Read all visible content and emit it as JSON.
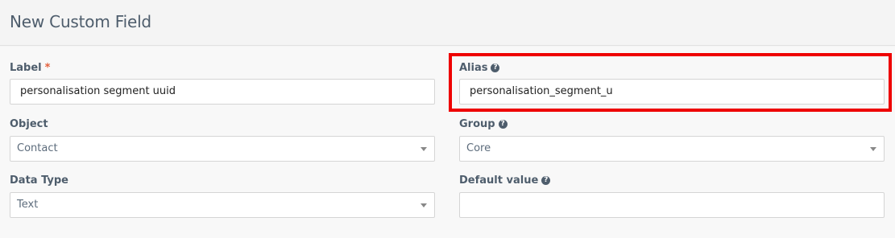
{
  "header": {
    "title": "New Custom Field"
  },
  "form": {
    "label": {
      "title": "Label",
      "required_mark": "*",
      "value": "personalisation segment uuid"
    },
    "alias": {
      "title": "Alias",
      "help_icon": "question-circle-icon",
      "value": "personalisation_segment_u"
    },
    "object": {
      "title": "Object",
      "selected": "Contact"
    },
    "group": {
      "title": "Group",
      "help_icon": "question-circle-icon",
      "selected": "Core"
    },
    "data_type": {
      "title": "Data Type",
      "selected": "Text"
    },
    "default_value": {
      "title": "Default value",
      "help_icon": "question-circle-icon",
      "value": ""
    }
  },
  "colors": {
    "highlight": "#ee0000",
    "required": "#e4603c",
    "text": "#4e5d6c"
  }
}
